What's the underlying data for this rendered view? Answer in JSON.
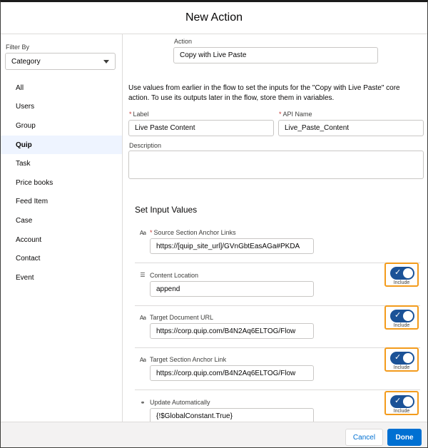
{
  "modal": {
    "title": "New Action"
  },
  "sidebar": {
    "filter_label": "Filter By",
    "filter_value": "Category",
    "items": [
      {
        "label": "All"
      },
      {
        "label": "Users"
      },
      {
        "label": "Group"
      },
      {
        "label": "Quip",
        "active": true
      },
      {
        "label": "Task"
      },
      {
        "label": "Price books"
      },
      {
        "label": "Feed Item"
      },
      {
        "label": "Case"
      },
      {
        "label": "Account"
      },
      {
        "label": "Contact"
      },
      {
        "label": "Event"
      }
    ]
  },
  "form": {
    "action_label": "Action",
    "action_value": "Copy with Live Paste",
    "description_text": "Use values from earlier in the flow to set the inputs for the \"Copy with Live Paste\" core action. To use its outputs later in the flow, store them in variables.",
    "label_label": "Label",
    "label_value": "Live Paste Content",
    "api_name_label": "API Name",
    "api_name_value": "Live_Paste_Content",
    "desc_label": "Description",
    "desc_value": "",
    "required_marker": "*"
  },
  "inputs": {
    "section_title": "Set Input Values",
    "rows": [
      {
        "label": "Source Section Anchor Links",
        "required": true,
        "icon": "text-type-icon",
        "value": "https://[quip_site_url]/GVnGbtEasAGa#PKDA",
        "has_toggle": false
      },
      {
        "label": "Content Location",
        "required": false,
        "icon": "list-icon",
        "value": "append",
        "has_toggle": true
      },
      {
        "label": "Target Document URL",
        "required": false,
        "icon": "text-type-icon",
        "value": "https://corp.quip.com/B4N2Aq6ELTOG/Flow",
        "has_toggle": true
      },
      {
        "label": "Target Section Anchor Link",
        "required": false,
        "icon": "text-type-icon",
        "value": "https://corp.quip.com/B4N2Aq6ELTOG/Flow",
        "has_toggle": true
      },
      {
        "label": "Update Automatically",
        "required": false,
        "icon": "boolean-icon",
        "value": "{!$GlobalConstant.True}",
        "has_toggle": true
      }
    ],
    "toggle_label": "Include"
  },
  "footer": {
    "cancel_label": "Cancel",
    "done_label": "Done"
  },
  "colors": {
    "accent": "#0070d2",
    "toggle_on": "#1b5297",
    "highlight": "#f39b1c",
    "active_item_bg": "#eef4ff"
  }
}
